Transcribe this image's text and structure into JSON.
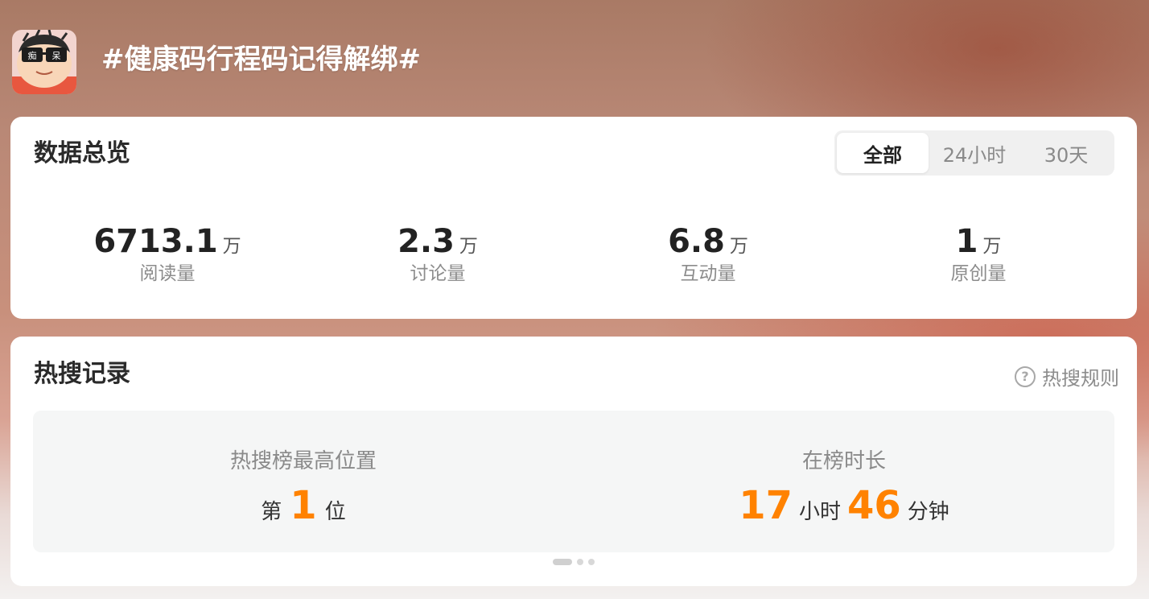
{
  "header": {
    "avatar_text": [
      "痴",
      "呆"
    ],
    "topic_title": "#健康码行程码记得解绑#"
  },
  "overview": {
    "title": "数据总览",
    "tabs": [
      {
        "label": "全部",
        "active": true
      },
      {
        "label": "24小时",
        "active": false
      },
      {
        "label": "30天",
        "active": false
      }
    ],
    "stats": [
      {
        "value": "6713.1",
        "unit": "万",
        "label": "阅读量"
      },
      {
        "value": "2.3",
        "unit": "万",
        "label": "讨论量"
      },
      {
        "value": "6.8",
        "unit": "万",
        "label": "互动量"
      },
      {
        "value": "1",
        "unit": "万",
        "label": "原创量"
      }
    ]
  },
  "hot_search": {
    "title": "热搜记录",
    "rules_label": "热搜规则",
    "peak": {
      "label": "热搜榜最高位置",
      "prefix": "第",
      "value": "1",
      "suffix": "位"
    },
    "duration": {
      "label": "在榜时长",
      "hours": "17",
      "hours_unit": "小时",
      "minutes": "46",
      "minutes_unit": "分钟"
    },
    "pager": {
      "pages": 3,
      "current": 1
    }
  },
  "colors": {
    "accent_orange": "#ff8200",
    "card_bg": "#ffffff",
    "record_bg": "#f5f6f6"
  }
}
